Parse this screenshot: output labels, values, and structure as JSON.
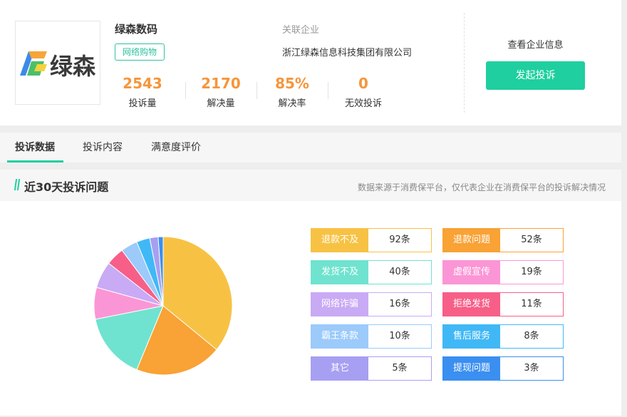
{
  "company": {
    "logo_text": "绿森",
    "name": "绿森数码",
    "tag": "网络购物",
    "related_label": "关联企业",
    "related_value": "浙江绿森信息科技集团有限公司",
    "view_info": "查看企业信息",
    "complain_button": "发起投诉"
  },
  "stats": [
    {
      "value": "2543",
      "label": "投诉量"
    },
    {
      "value": "2170",
      "label": "解决量"
    },
    {
      "value": "85%",
      "label": "解决率"
    },
    {
      "value": "0",
      "label": "无效投诉"
    }
  ],
  "tabs": [
    {
      "label": "投诉数据"
    },
    {
      "label": "投诉内容"
    },
    {
      "label": "满意度评价"
    }
  ],
  "section": {
    "title": "近30天投诉问题",
    "note": "数据来源于消费保平台，仅代表企业在消费保平台的投诉解决情况"
  },
  "chart_data": {
    "type": "pie",
    "categories": [
      "退款不及",
      "退款问题",
      "发货不及",
      "虚假宣传",
      "网络诈骗",
      "拒绝发货",
      "霸王条款",
      "售后服务",
      "其它",
      "提现问题"
    ],
    "values": [
      92,
      52,
      40,
      19,
      16,
      11,
      10,
      8,
      5,
      3
    ],
    "counts": [
      "92条",
      "52条",
      "40条",
      "19条",
      "16条",
      "11条",
      "10条",
      "8条",
      "5条",
      "3条"
    ],
    "colors": [
      "#f7c244",
      "#f9a235",
      "#6fe3cf",
      "#fb96d6",
      "#c9aaf5",
      "#f75f88",
      "#9bcafb",
      "#41b8f6",
      "#a79ff2",
      "#3a8ff0"
    ]
  }
}
